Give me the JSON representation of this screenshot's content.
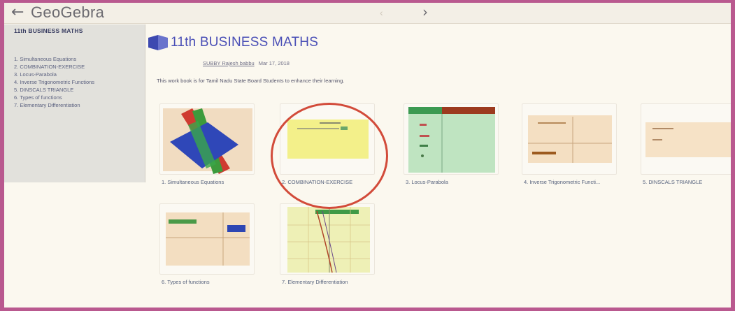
{
  "app": {
    "back_icon": "arrow-left-icon",
    "title": "GeoGebra"
  },
  "nav": {
    "prev_indicator": "‹",
    "next_icon": "chevron-right-icon"
  },
  "sidebar": {
    "title": "11th BUSINESS MATHS",
    "items": [
      {
        "label": "1. Simultaneous Equations"
      },
      {
        "label": "2. COMBINATION-EXERCISE"
      },
      {
        "label": "3. Locus-Parabola"
      },
      {
        "label": "4. Inverse Trigonometric Functions"
      },
      {
        "label": "5. DINSCALS TRIANGLE"
      },
      {
        "label": "6. Types of functions"
      },
      {
        "label": "7. Elementary Differentiation"
      }
    ]
  },
  "book": {
    "icon": "book-icon",
    "title": "11th BUSINESS MATHS",
    "author": "SUBBY Rajesh babbu",
    "date": "Mar 17, 2018",
    "description": "This work book is for Tamil Nadu State Board Students to enhance their learning."
  },
  "cards": [
    {
      "label": "1. Simultaneous Equations"
    },
    {
      "label": "2. COMBINATION-EXERCISE"
    },
    {
      "label": "3. Locus-Parabola"
    },
    {
      "label": "4. Inverse Trigonometric Functi..."
    },
    {
      "label": "5. DINSCALS TRIANGLE"
    },
    {
      "label": "6. Types of functions"
    },
    {
      "label": "7. Elementary Differentiation"
    }
  ],
  "colors": {
    "frame_border": "#b9598f",
    "accent_blue": "#4a4fb6",
    "highlight_red": "#d24b3a",
    "sidebar_bg": "#e2e1dc"
  }
}
